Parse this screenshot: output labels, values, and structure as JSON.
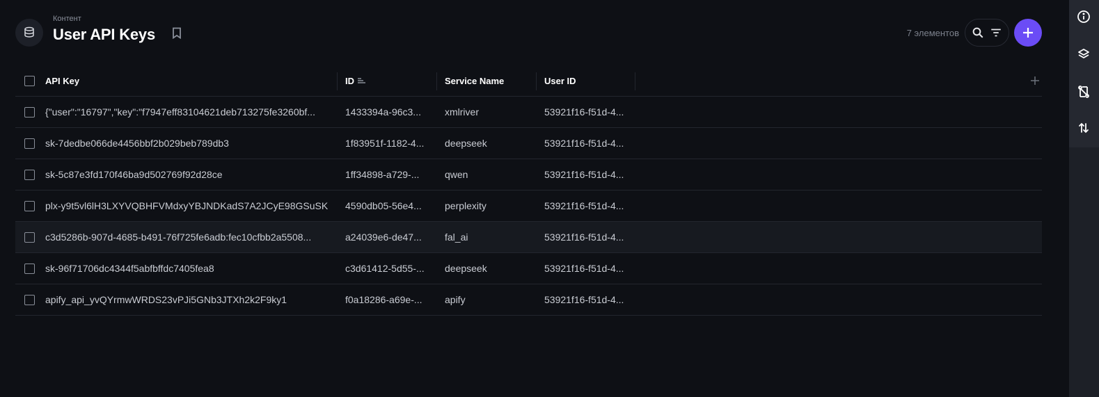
{
  "header": {
    "breadcrumb": "Контент",
    "title": "User API Keys",
    "item_count": "7 элементов"
  },
  "icons": {
    "collection": "database-icon",
    "bookmark": "bookmark-icon",
    "search": "search-icon",
    "filter": "filter-icon",
    "add": "plus-icon",
    "info": "info-icon",
    "layers": "layers-icon",
    "versions": "git-compare-icon",
    "sync": "arrows-up-down-icon"
  },
  "colors": {
    "accent": "#6b4cf6",
    "background": "#0e1015",
    "rail": "#1d2027"
  },
  "table": {
    "columns": [
      "API Key",
      "ID",
      "Service Name",
      "User ID"
    ],
    "rows": [
      {
        "api_key": "{\"user\":\"16797\",\"key\":\"f7947eff83104621deb713275fe3260bf...",
        "id": "1433394a-96c3...",
        "service": "xmlriver",
        "user_id": "53921f16-f51d-4..."
      },
      {
        "api_key": "sk-7dedbe066de4456bbf2b029beb789db3",
        "id": "1f83951f-1182-4...",
        "service": "deepseek",
        "user_id": "53921f16-f51d-4..."
      },
      {
        "api_key": "sk-5c87e3fd170f46ba9d502769f92d28ce",
        "id": "1ff34898-a729-...",
        "service": "qwen",
        "user_id": "53921f16-f51d-4..."
      },
      {
        "api_key": "plx-y9t5vl6lH3LXYVQBHFVMdxyYBJNDKadS7A2JCyE98GSuSK",
        "id": "4590db05-56e4...",
        "service": "perplexity",
        "user_id": "53921f16-f51d-4..."
      },
      {
        "api_key": "c3d5286b-907d-4685-b491-76f725fe6adb:fec10cfbb2a5508...",
        "id": "a24039e6-de47...",
        "service": "fal_ai",
        "user_id": "53921f16-f51d-4..."
      },
      {
        "api_key": "sk-96f71706dc4344f5abfbffdc7405fea8",
        "id": "c3d61412-5d55-...",
        "service": "deepseek",
        "user_id": "53921f16-f51d-4..."
      },
      {
        "api_key": "apify_api_yvQYrmwWRDS23vPJi5GNb3JTXh2k2F9ky1",
        "id": "f0a18286-a69e-...",
        "service": "apify",
        "user_id": "53921f16-f51d-4..."
      }
    ]
  }
}
